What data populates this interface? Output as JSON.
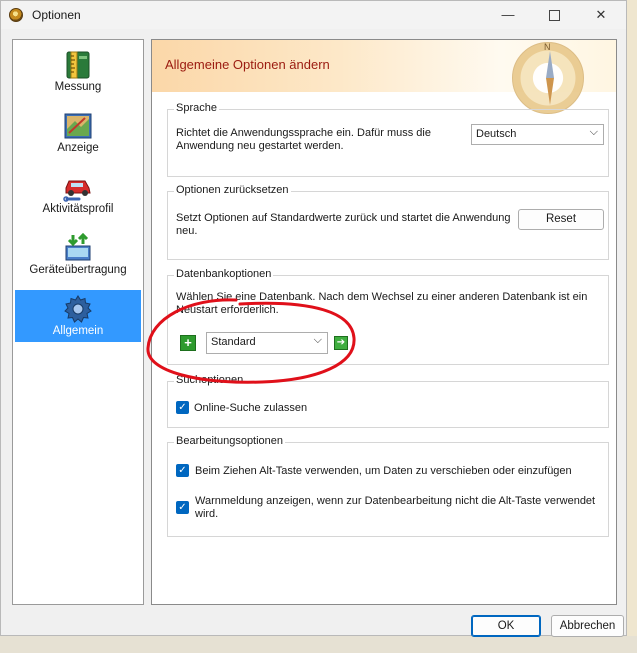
{
  "window": {
    "title": "Optionen",
    "minimize_glyph": "—",
    "close_glyph": "✕"
  },
  "sidebar": {
    "items": [
      {
        "label": "Messung",
        "icon": "ruler-book-icon",
        "active": false
      },
      {
        "label": "Anzeige",
        "icon": "map-display-icon",
        "active": false
      },
      {
        "label": "Aktivitätsprofil",
        "icon": "car-wrench-icon",
        "active": false
      },
      {
        "label": "Geräteübertragung",
        "icon": "device-transfer-icon",
        "active": false
      },
      {
        "label": "Allgemein",
        "icon": "gear-icon",
        "active": true
      }
    ]
  },
  "header": {
    "title": "Allgemeine Optionen ändern"
  },
  "groups": {
    "language": {
      "legend": "Sprache",
      "text_line1": "Richtet die Anwendungssprache ein. Dafür muss die",
      "text_line2": "Anwendung neu gestartet werden.",
      "select_value": "Deutsch"
    },
    "reset": {
      "legend": "Optionen zurücksetzen",
      "text_line1": "Setzt Optionen auf Standardwerte zurück und startet die Anwendung",
      "text_line2": "neu.",
      "button_label": "Reset"
    },
    "database": {
      "legend": "Datenbankoptionen",
      "text_line1": "Wählen Sie eine Datenbank. Nach dem Wechsel zu einer anderen Datenbank ist ein",
      "text_line2": "Neustart erforderlich.",
      "add_glyph": "+",
      "select_value": "Standard",
      "go_glyph": "➔"
    },
    "search": {
      "legend": "Suchoptionen",
      "checkbox_label": "Online-Suche zulassen",
      "checked": true
    },
    "editing": {
      "legend": "Bearbeitungsoptionen",
      "checkbox1_label": "Beim Ziehen Alt-Taste verwenden, um Daten zu verschieben oder einzufügen",
      "checkbox2_line1": "Warnmeldung anzeigen, wenn zur Datenbearbeitung nicht die Alt-Taste verwendet",
      "checkbox2_line2": "wird.",
      "checkbox1_checked": true,
      "checkbox2_checked": true
    }
  },
  "footer": {
    "ok_label": "OK",
    "cancel_label": "Abbrechen"
  },
  "colors": {
    "accent": "#0067c0",
    "selection": "#3399ff",
    "header_title": "#9b1b10",
    "annotation": "#e0101a"
  }
}
